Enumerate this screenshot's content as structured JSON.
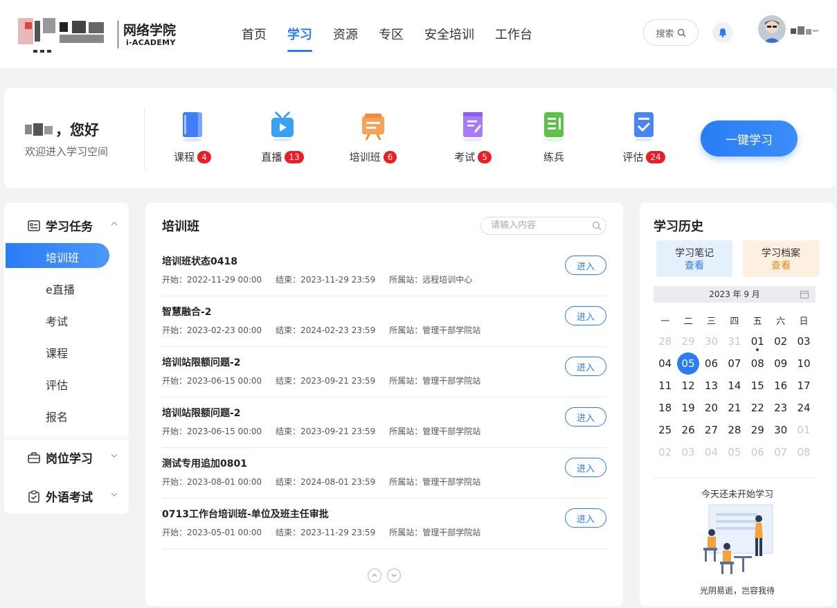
{
  "header": {
    "logo_cn": "网络学院",
    "logo_en": "i-ACADEMY",
    "nav": [
      "首页",
      "学习",
      "资源",
      "专区",
      "安全培训",
      "工作台"
    ],
    "active_nav": "学习",
    "search_label": "搜索"
  },
  "welcome": {
    "greeting": "，您好",
    "subtitle": "欢迎进入学习空间",
    "quick": [
      {
        "label": "课程",
        "badge": "4",
        "icon": "course-icon"
      },
      {
        "label": "直播",
        "badge": "13",
        "icon": "live-icon"
      },
      {
        "label": "培训班",
        "badge": "6",
        "icon": "training-class-icon"
      },
      {
        "label": "考试",
        "badge": "5",
        "icon": "exam-icon"
      },
      {
        "label": "练兵",
        "badge": "",
        "icon": "practice-icon"
      },
      {
        "label": "评估",
        "badge": "24",
        "icon": "assessment-icon"
      }
    ],
    "one_key": "一键学习"
  },
  "leftmenu": {
    "group1": "学习任务",
    "items": [
      "培训班",
      "e直播",
      "考试",
      "课程",
      "评估",
      "报名"
    ],
    "group2": "岗位学习",
    "group3": "外语考试"
  },
  "list": {
    "title": "培训班",
    "search_placeholder": "请输入内容",
    "enter_label": "进入",
    "rows": [
      {
        "title": "培训班状态0418",
        "start": "开始：2022-11-29 00:00",
        "end": "结束：2023-11-29 23:59",
        "site": "所属站：远程培训中心"
      },
      {
        "title": "智慧融合-2",
        "start": "开始：2023-02-23 00:00",
        "end": "结束：2024-02-23 23:59",
        "site": "所属站：管理干部学院站"
      },
      {
        "title": "培训站限额问题-2",
        "start": "开始：2023-06-15 00:00",
        "end": "结束：2023-09-21 23:59",
        "site": "所属站：管理干部学院站"
      },
      {
        "title": "培训站限额问题-2",
        "start": "开始：2023-06-15 00:00",
        "end": "结束：2023-09-21 23:59",
        "site": "所属站：管理干部学院站"
      },
      {
        "title": "测试专用追加0801",
        "start": "开始：2023-08-01 00:00",
        "end": "结束：2024-08-01 23:59",
        "site": "所属站：管理干部学院站"
      },
      {
        "title": "0713工作台培训班-单位及班主任审批",
        "start": "开始：2023-05-01 00:00",
        "end": "结束：2023-11-29 23:59",
        "site": "所属站：管理干部学院站"
      }
    ]
  },
  "history": {
    "title": "学习历史",
    "notes_label": "学习笔记",
    "notes_link": "查看",
    "archive_label": "学习档案",
    "archive_link": "查看",
    "month": "2023 年 9 月",
    "weekdays": [
      "一",
      "二",
      "三",
      "四",
      "五",
      "六",
      "日"
    ],
    "days": [
      [
        "28",
        "m"
      ],
      [
        "29",
        "m"
      ],
      [
        "30",
        "m"
      ],
      [
        "31",
        "m"
      ],
      [
        "01",
        "d"
      ],
      [
        "02",
        ""
      ],
      [
        "03",
        ""
      ],
      [
        "04",
        ""
      ],
      [
        "05",
        "t"
      ],
      [
        "06",
        ""
      ],
      [
        "07",
        ""
      ],
      [
        "08",
        ""
      ],
      [
        "09",
        ""
      ],
      [
        "10",
        ""
      ],
      [
        "11",
        ""
      ],
      [
        "12",
        ""
      ],
      [
        "13",
        ""
      ],
      [
        "14",
        ""
      ],
      [
        "15",
        ""
      ],
      [
        "16",
        ""
      ],
      [
        "17",
        ""
      ],
      [
        "18",
        ""
      ],
      [
        "19",
        ""
      ],
      [
        "20",
        ""
      ],
      [
        "21",
        ""
      ],
      [
        "22",
        ""
      ],
      [
        "23",
        ""
      ],
      [
        "24",
        ""
      ],
      [
        "25",
        ""
      ],
      [
        "26",
        ""
      ],
      [
        "27",
        ""
      ],
      [
        "28",
        ""
      ],
      [
        "29",
        ""
      ],
      [
        "30",
        ""
      ],
      [
        "01",
        "m"
      ],
      [
        "02",
        "m"
      ],
      [
        "03",
        "m"
      ],
      [
        "04",
        "m"
      ],
      [
        "05",
        "m"
      ],
      [
        "06",
        "m"
      ],
      [
        "07",
        "m"
      ],
      [
        "08",
        "m"
      ]
    ],
    "empty_text": "今天还未开始学习",
    "quote": "光阴易逝，岂容我待"
  },
  "colors": {
    "accent": "#2a7cf6",
    "badge": "#ee1c25"
  }
}
